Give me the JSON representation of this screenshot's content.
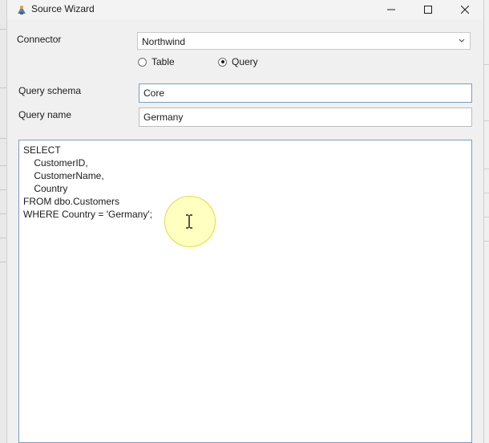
{
  "window": {
    "title": "Source Wizard",
    "app_icon": "wizard-icon",
    "controls": [
      "minimize-icon",
      "maximize-icon",
      "close-icon"
    ]
  },
  "form": {
    "connector_label": "Connector",
    "connector_value": "Northwind",
    "source_type_options": [
      {
        "label": "Table",
        "selected": false
      },
      {
        "label": "Query",
        "selected": true
      }
    ],
    "query_schema_label": "Query schema",
    "query_schema_value": "Core",
    "query_name_label": "Query name",
    "query_name_value": "Germany"
  },
  "query": {
    "lines": [
      "SELECT",
      "    CustomerID,",
      "    CustomerName,",
      "    Country",
      "FROM dbo.Customers",
      "WHERE Country = 'Germany';"
    ]
  },
  "colors": {
    "focus_border": "#7a9cc6",
    "cursor_highlight": "#ffff8c"
  }
}
